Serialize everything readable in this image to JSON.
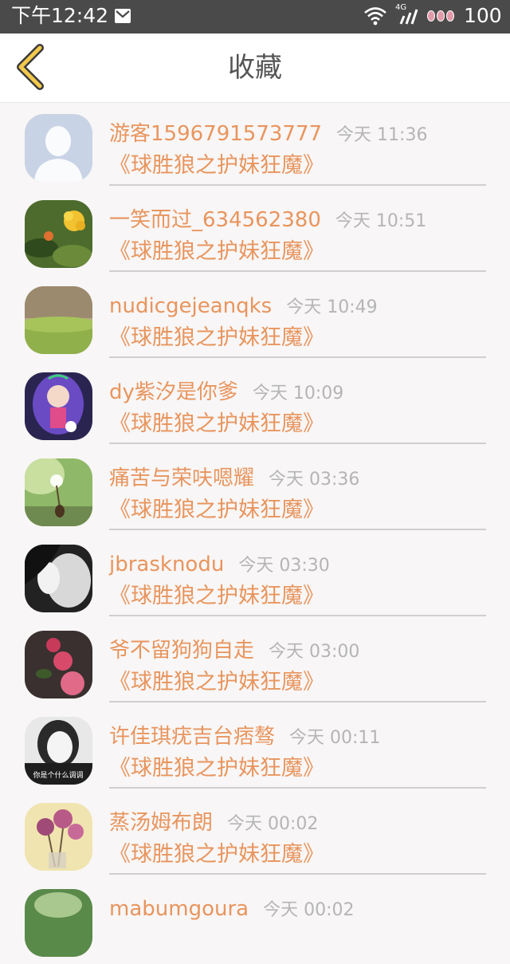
{
  "status_bar": {
    "time": "下午12:42",
    "network": "4G",
    "battery": "100"
  },
  "header": {
    "title": "收藏"
  },
  "colors": {
    "accent": "#e8955e",
    "back_icon": "#f2c94c",
    "status_bar_bg": "#4a4a4a"
  },
  "items": [
    {
      "name": "游客1596791573777",
      "time": "今天 11:36",
      "book": "《球胜狼之护妹狂魔》",
      "avatar": "default-avatar-icon"
    },
    {
      "name": "一笑而过_634562380",
      "time": "今天 10:51",
      "book": "《球胜狼之护妹狂魔》",
      "avatar": "flowers-avatar"
    },
    {
      "name": "nudicgejeanqks",
      "time": "今天 10:49",
      "book": "《球胜狼之护妹狂魔》",
      "avatar": "grass-avatar"
    },
    {
      "name": "dy紫汐是你爹",
      "time": "今天 10:09",
      "book": "《球胜狼之护妹狂魔》",
      "avatar": "anime-girl-avatar"
    },
    {
      "name": "痛苦与荣呋嗯耀",
      "time": "今天 03:36",
      "book": "《球胜狼之护妹狂魔》",
      "avatar": "dandelion-avatar"
    },
    {
      "name": "jbrasknodu",
      "time": "今天 03:30",
      "book": "《球胜狼之护妹狂魔》",
      "avatar": "bw-portrait-avatar"
    },
    {
      "name": "爷不留狗狗自走",
      "time": "今天 03:00",
      "book": "《球胜狼之护妹狂魔》",
      "avatar": "roses-avatar"
    },
    {
      "name": "许佳琪疣吉台痞骜",
      "time": "今天 00:11",
      "book": "《球胜狼之护妹狂魔》",
      "avatar": "girl-caption-avatar",
      "avatar_caption": "你是个什么调调"
    },
    {
      "name": "蒸汤姆布朗",
      "time": "今天 00:02",
      "book": "《球胜狼之护妹狂魔》",
      "avatar": "pink-roses-avatar"
    },
    {
      "name": "mabumgoura",
      "time": "今天 00:02",
      "book": "",
      "avatar": "green-avatar"
    }
  ]
}
